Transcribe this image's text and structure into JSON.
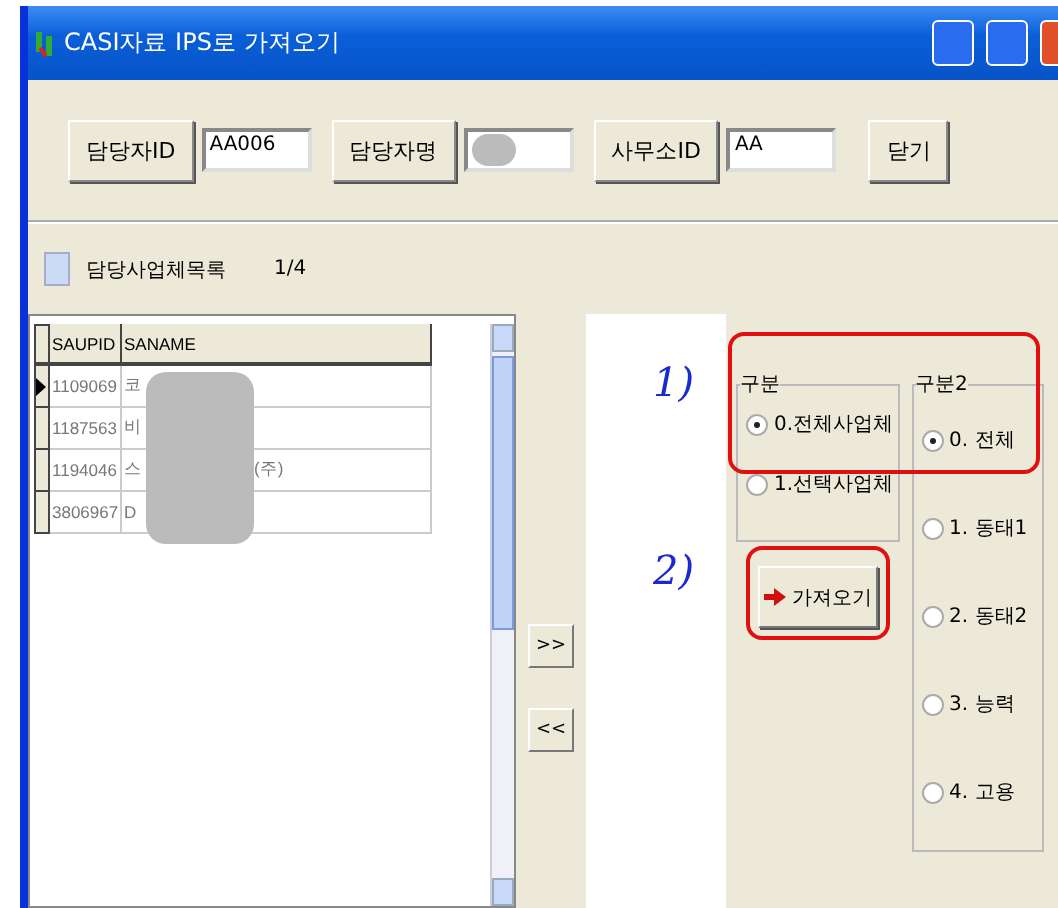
{
  "window": {
    "title": "CASI자료 IPS로 가져오기"
  },
  "toolbar": [
    {
      "kind": "label",
      "text": "담당자ID"
    },
    {
      "kind": "field",
      "value": "AA006"
    },
    {
      "kind": "label",
      "text": "담당자명"
    },
    {
      "kind": "field",
      "redacted": true
    },
    {
      "kind": "label",
      "text": "사무소ID"
    },
    {
      "kind": "field",
      "value": "AA"
    },
    {
      "kind": "button",
      "text": "닫기"
    }
  ],
  "list_header": {
    "label": "담당사업체목록",
    "count": "1/4"
  },
  "grid": {
    "columns": [
      "SAUPID",
      "SANAME"
    ],
    "redacted": true,
    "rows": [
      {
        "saup_id": "1109069",
        "saname": "코",
        "selected": true
      },
      {
        "saup_id": "1187563",
        "saname": "비",
        "selected": false
      },
      {
        "saup_id": "1194046",
        "saname": "스",
        "tail": "(주)",
        "selected": false
      },
      {
        "saup_id": "3806967",
        "saname": "D",
        "selected": false
      }
    ]
  },
  "move_buttons": [
    ">>",
    "<<"
  ],
  "annotations": [
    "1)",
    "2)"
  ],
  "group1": {
    "title": "구분",
    "options": [
      {
        "label": "0.전체사업체",
        "selected": true
      },
      {
        "label": "1.선택사업체",
        "selected": false
      }
    ]
  },
  "fetch_button": {
    "label": "가져오기"
  },
  "group2": {
    "title": "구분2",
    "options": [
      {
        "label": "0. 전체",
        "selected": true
      },
      {
        "label": "1. 동태1",
        "selected": false
      },
      {
        "label": "2. 동태2",
        "selected": false
      },
      {
        "label": "3. 능력",
        "selected": false
      },
      {
        "label": "4. 고용",
        "selected": false
      }
    ]
  }
}
